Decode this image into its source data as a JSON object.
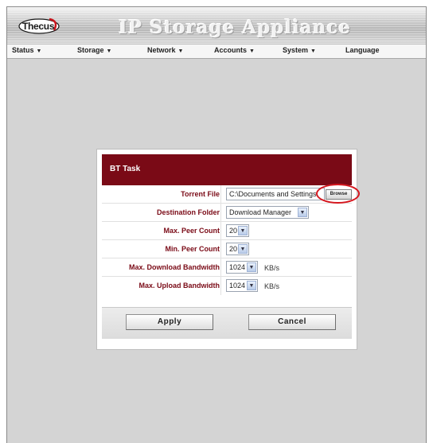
{
  "header": {
    "logo_text": "Thecus",
    "app_title": "IP Storage Appliance"
  },
  "menu": [
    {
      "label": "Status",
      "dropdown": true
    },
    {
      "label": "Storage",
      "dropdown": true
    },
    {
      "label": "Network",
      "dropdown": true
    },
    {
      "label": "Accounts",
      "dropdown": true
    },
    {
      "label": "System",
      "dropdown": true
    },
    {
      "label": "Language",
      "dropdown": false
    }
  ],
  "dialog": {
    "title": "BT Task",
    "fields": {
      "torrent_file": {
        "label": "Torrent File",
        "value": "C:\\Documents and Settings",
        "browse_label": "Browse"
      },
      "destination_folder": {
        "label": "Destination Folder",
        "value": "Download Manager"
      },
      "max_peer_count": {
        "label": "Max. Peer Count",
        "value": "20"
      },
      "min_peer_count": {
        "label": "Min. Peer Count",
        "value": "20"
      },
      "max_download_bandwidth": {
        "label": "Max. Download Bandwidth",
        "value": "1024",
        "unit": "KB/s"
      },
      "max_upload_bandwidth": {
        "label": "Max. Upload Bandwidth",
        "value": "1024",
        "unit": "KB/s"
      }
    },
    "apply_label": "Apply",
    "cancel_label": "Cancel"
  },
  "colors": {
    "accent": "#7a0a16",
    "highlight": "#d6171f"
  },
  "icons": {
    "dropdown": "chevron-down-icon",
    "menu_arrow": "triangle-down-icon"
  }
}
